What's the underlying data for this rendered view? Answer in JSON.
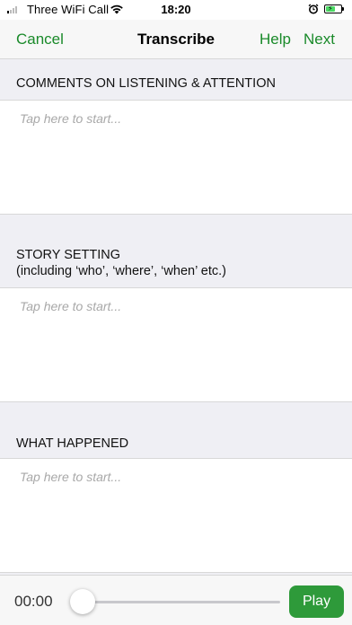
{
  "status_bar": {
    "carrier": "Three WiFi Call",
    "time": "18:20",
    "battery_color": "#4cd964"
  },
  "nav": {
    "cancel": "Cancel",
    "title": "Transcribe",
    "help": "Help",
    "next": "Next",
    "accent_color": "#1a8a2a"
  },
  "sections": [
    {
      "header": "COMMENTS ON LISTENING & ATTENTION",
      "placeholder": "Tap here to start..."
    },
    {
      "header_line1": "STORY SETTING",
      "header_line2": "(including ‘who’, ‘where’, ‘when’ etc.)",
      "placeholder": "Tap here to start..."
    },
    {
      "header": "WHAT HAPPENED",
      "placeholder": "Tap here to start..."
    }
  ],
  "player": {
    "time": "00:00",
    "play_label": "Play",
    "progress": 0
  }
}
